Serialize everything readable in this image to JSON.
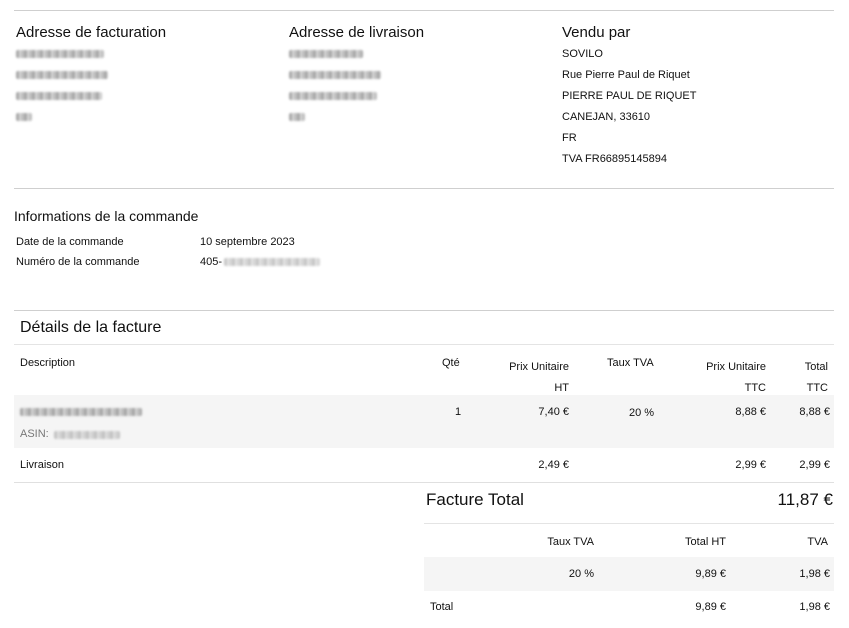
{
  "billing": {
    "title": "Adresse de facturation",
    "redacted_lines": 4
  },
  "shipping": {
    "title": "Adresse de livraison",
    "redacted_lines": 4
  },
  "seller": {
    "title": "Vendu par",
    "lines": [
      "SOVILO",
      "Rue Pierre Paul de Riquet",
      "PIERRE PAUL DE RIQUET",
      "CANEJAN, 33610",
      "FR",
      "TVA FR66895145894"
    ]
  },
  "order_info": {
    "title": "Informations de la commande",
    "date_label": "Date de la commande",
    "date_value": "10 septembre 2023",
    "number_label": "Numéro de la commande",
    "number_prefix": "405-"
  },
  "invoice": {
    "title": "Détails de la facture",
    "headers": {
      "description": "Description",
      "qty": "Qté",
      "unit_ht_1": "Prix Unitaire",
      "unit_ht_2": "HT",
      "vat_rate": "Taux TVA",
      "unit_ttc_1": "Prix Unitaire",
      "unit_ttc_2": "TTC",
      "total_1": "Total",
      "total_2": "TTC"
    },
    "item": {
      "asin_label": "ASIN:",
      "qty": "1",
      "unit_ht": "7,40 €",
      "vat_rate": "20 %",
      "unit_ttc": "8,88 €",
      "total_ttc": "8,88 €"
    },
    "shipping_row": {
      "description": "Livraison",
      "unit_ht": "2,49 €",
      "unit_ttc": "2,99 €",
      "total_ttc": "2,99 €"
    }
  },
  "totals": {
    "label": "Facture Total",
    "value": "11,87 €",
    "headers": {
      "rate": "Taux TVA",
      "total_ht": "Total HT",
      "vat": "TVA"
    },
    "row": {
      "rate": "20 %",
      "total_ht": "9,89 €",
      "vat": "1,98 €"
    },
    "sum": {
      "label": "Total",
      "total_ht": "9,89 €",
      "vat": "1,98 €"
    }
  }
}
